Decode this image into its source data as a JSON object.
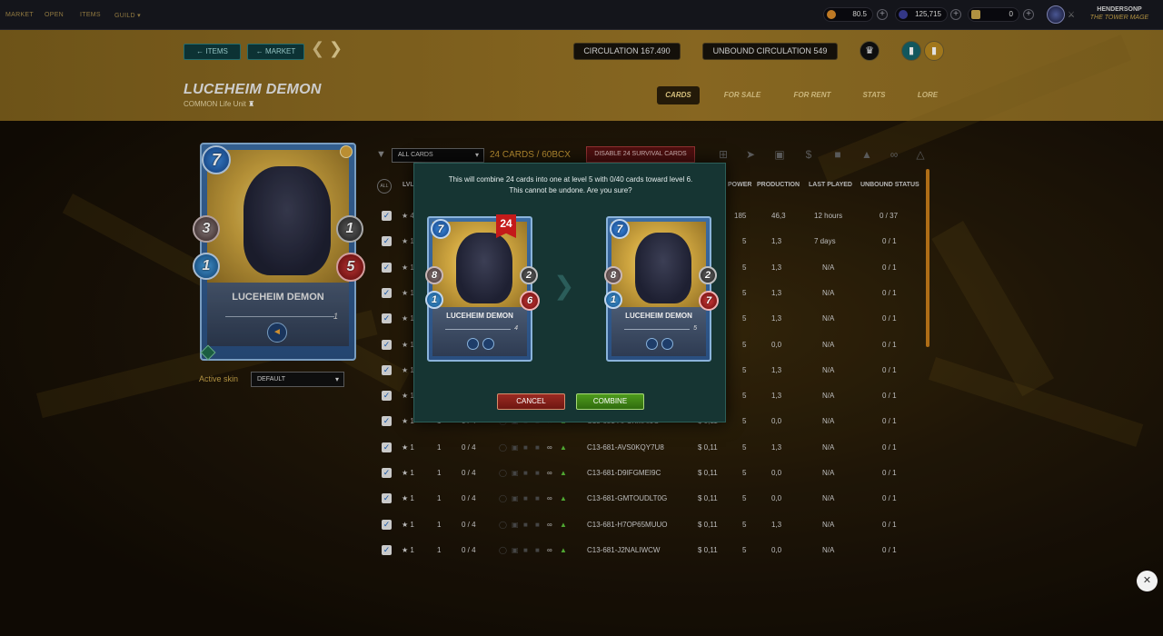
{
  "topnav": {
    "items": [
      "MARKET",
      "OPEN",
      "ITEMS",
      "GUILD ▾"
    ]
  },
  "resources": {
    "dec": "80.5",
    "credits": "125,715",
    "vouchers": "0"
  },
  "user": {
    "name": "HENDERSONP",
    "title": "THE TOWER MAGE"
  },
  "header": {
    "items_btn": "← ITEMS",
    "market_btn": "← MARKET",
    "prev": "❮",
    "next": "❯",
    "circulation": "CIRCULATION 167.490",
    "unbound_circulation": "UNBOUND CIRCULATION 549",
    "card_name": "LUCEHEIM DEMON",
    "card_meta": "COMMON Life  Unit",
    "tabs": [
      "CARDS",
      "FOR SALE",
      "FOR RENT",
      "STATS",
      "LORE"
    ]
  },
  "card": {
    "name": "LUCEHEIM DEMON",
    "mana": "7",
    "melee": "3",
    "armor": "1",
    "speed": "1",
    "health": "5",
    "level": "1",
    "active_skin_label": "Active skin",
    "skin": "DEFAULT"
  },
  "toolbar": {
    "filter": "ALL CARDS",
    "count": "24 CARDS / 60BCX",
    "disable_btn": "DISABLE 24 SURVIVAL CARDS"
  },
  "columns": {
    "all": "ALL",
    "lvl": "LVL",
    "power": "POWER",
    "production": "PRODUCTION",
    "last_played": "LAST PLAYED",
    "unbound_status": "UNBOUND STATUS"
  },
  "rows": [
    {
      "lvl": "★ 4",
      "power": "185",
      "production": "46,3",
      "last": "12 hours",
      "unbound": "0 / 37"
    },
    {
      "lvl": "★ 1",
      "power": "5",
      "production": "1,3",
      "last": "7 days",
      "unbound": "0 / 1"
    },
    {
      "lvl": "★ 1",
      "power": "5",
      "production": "1,3",
      "last": "N/A",
      "unbound": "0 / 1"
    },
    {
      "lvl": "★ 1",
      "power": "5",
      "production": "1,3",
      "last": "N/A",
      "unbound": "0 / 1"
    },
    {
      "lvl": "★ 1",
      "power": "5",
      "production": "1,3",
      "last": "N/A",
      "unbound": "0 / 1"
    },
    {
      "lvl": "★ 1",
      "power": "5",
      "production": "0,0",
      "last": "N/A",
      "unbound": "0 / 1"
    },
    {
      "lvl": "★ 1",
      "power": "5",
      "production": "1,3",
      "last": "N/A",
      "unbound": "0 / 1"
    },
    {
      "lvl": "★ 1",
      "power": "5",
      "production": "1,3",
      "last": "N/A",
      "unbound": "0 / 1"
    },
    {
      "lvl": "★ 1",
      "bcx": "1",
      "xp": "0 / 4",
      "id": "C13-681-AFCKMAI9C",
      "price": "$ 0,11",
      "power": "5",
      "production": "0,0",
      "last": "N/A",
      "unbound": "0 / 1"
    },
    {
      "lvl": "★ 1",
      "bcx": "1",
      "xp": "0 / 4",
      "id": "C13-681-AVS0KQY7U8",
      "price": "$ 0,11",
      "power": "5",
      "production": "1,3",
      "last": "N/A",
      "unbound": "0 / 1"
    },
    {
      "lvl": "★ 1",
      "bcx": "1",
      "xp": "0 / 4",
      "id": "C13-681-D9IFGMEI9C",
      "price": "$ 0,11",
      "power": "5",
      "production": "0,0",
      "last": "N/A",
      "unbound": "0 / 1"
    },
    {
      "lvl": "★ 1",
      "bcx": "1",
      "xp": "0 / 4",
      "id": "C13-681-GMTOUDLT0G",
      "price": "$ 0,11",
      "power": "5",
      "production": "0,0",
      "last": "N/A",
      "unbound": "0 / 1"
    },
    {
      "lvl": "★ 1",
      "bcx": "1",
      "xp": "0 / 4",
      "id": "C13-681-H7OP65MUUO",
      "price": "$ 0,11",
      "power": "5",
      "production": "1,3",
      "last": "N/A",
      "unbound": "0 / 1"
    },
    {
      "lvl": "★ 1",
      "bcx": "1",
      "xp": "0 / 4",
      "id": "C13-681-J2NALIWCW",
      "price": "$ 0,11",
      "power": "5",
      "production": "0,0",
      "last": "N/A",
      "unbound": "0 / 1"
    }
  ],
  "modal": {
    "message_line1": "This will combine 24 cards into one at level 5 with 0/40 cards toward level 6.",
    "message_line2": "This cannot be undone. Are you sure?",
    "left_card": {
      "name": "LUCEHEIM DEMON",
      "count": "24",
      "mana": "7",
      "melee": "8",
      "armor": "2",
      "speed": "1",
      "health": "6",
      "level": "4"
    },
    "right_card": {
      "name": "LUCEHEIM DEMON",
      "mana": "7",
      "melee": "8",
      "armor": "2",
      "speed": "1",
      "health": "7",
      "level": "5"
    },
    "cancel": "CANCEL",
    "combine": "COMBINE"
  },
  "close_fab": "✕"
}
